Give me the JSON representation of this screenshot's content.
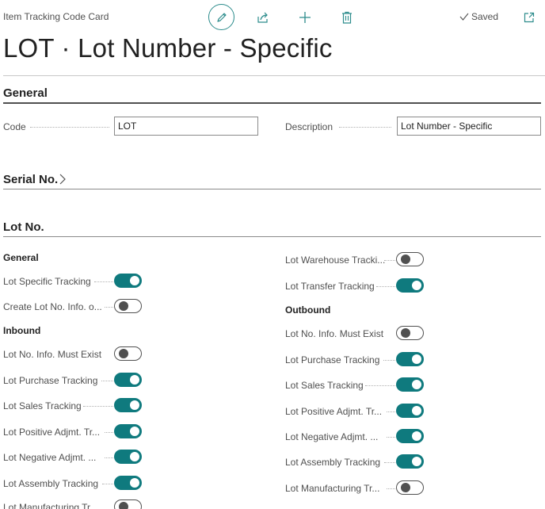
{
  "header": {
    "breadcrumb": "Item Tracking Code Card",
    "saved_label": "Saved",
    "icons": [
      "edit-icon",
      "share-icon",
      "new-icon",
      "delete-icon",
      "check-icon",
      "open-new-window-icon"
    ],
    "accent": "#0f7a7e"
  },
  "title": "LOT · Lot Number - Specific",
  "general": {
    "heading": "General",
    "code_label": "Code",
    "code_value": "LOT",
    "description_label": "Description",
    "description_value": "Lot Number - Specific"
  },
  "serial": {
    "heading": "Serial No."
  },
  "lot": {
    "heading": "Lot No.",
    "left": {
      "general_heading": "General",
      "general_items": [
        {
          "label": "Lot Specific Tracking",
          "on": true
        },
        {
          "label": "Create Lot No. Info. o...",
          "on": false
        }
      ],
      "inbound_heading": "Inbound",
      "inbound_items": [
        {
          "label": "Lot No. Info. Must Exist",
          "on": false
        },
        {
          "label": "Lot Purchase Tracking",
          "on": true
        },
        {
          "label": "Lot Sales Tracking",
          "on": true
        },
        {
          "label": "Lot Positive Adjmt. Tr...",
          "on": true
        },
        {
          "label": "Lot Negative Adjmt. ...",
          "on": true
        },
        {
          "label": "Lot Assembly Tracking",
          "on": true
        },
        {
          "label": "Lot Manufacturing Tr...",
          "on": false
        }
      ]
    },
    "right": {
      "top_items": [
        {
          "label": "Lot Warehouse Tracki...",
          "on": false
        },
        {
          "label": "Lot Transfer Tracking",
          "on": true
        }
      ],
      "outbound_heading": "Outbound",
      "outbound_items": [
        {
          "label": "Lot No. Info. Must Exist",
          "on": false
        },
        {
          "label": "Lot Purchase Tracking",
          "on": true
        },
        {
          "label": "Lot Sales Tracking",
          "on": true
        },
        {
          "label": "Lot Positive Adjmt. Tr...",
          "on": true
        },
        {
          "label": "Lot Negative Adjmt. ...",
          "on": true
        },
        {
          "label": "Lot Assembly Tracking",
          "on": true
        },
        {
          "label": "Lot Manufacturing Tr...",
          "on": false
        }
      ]
    }
  }
}
